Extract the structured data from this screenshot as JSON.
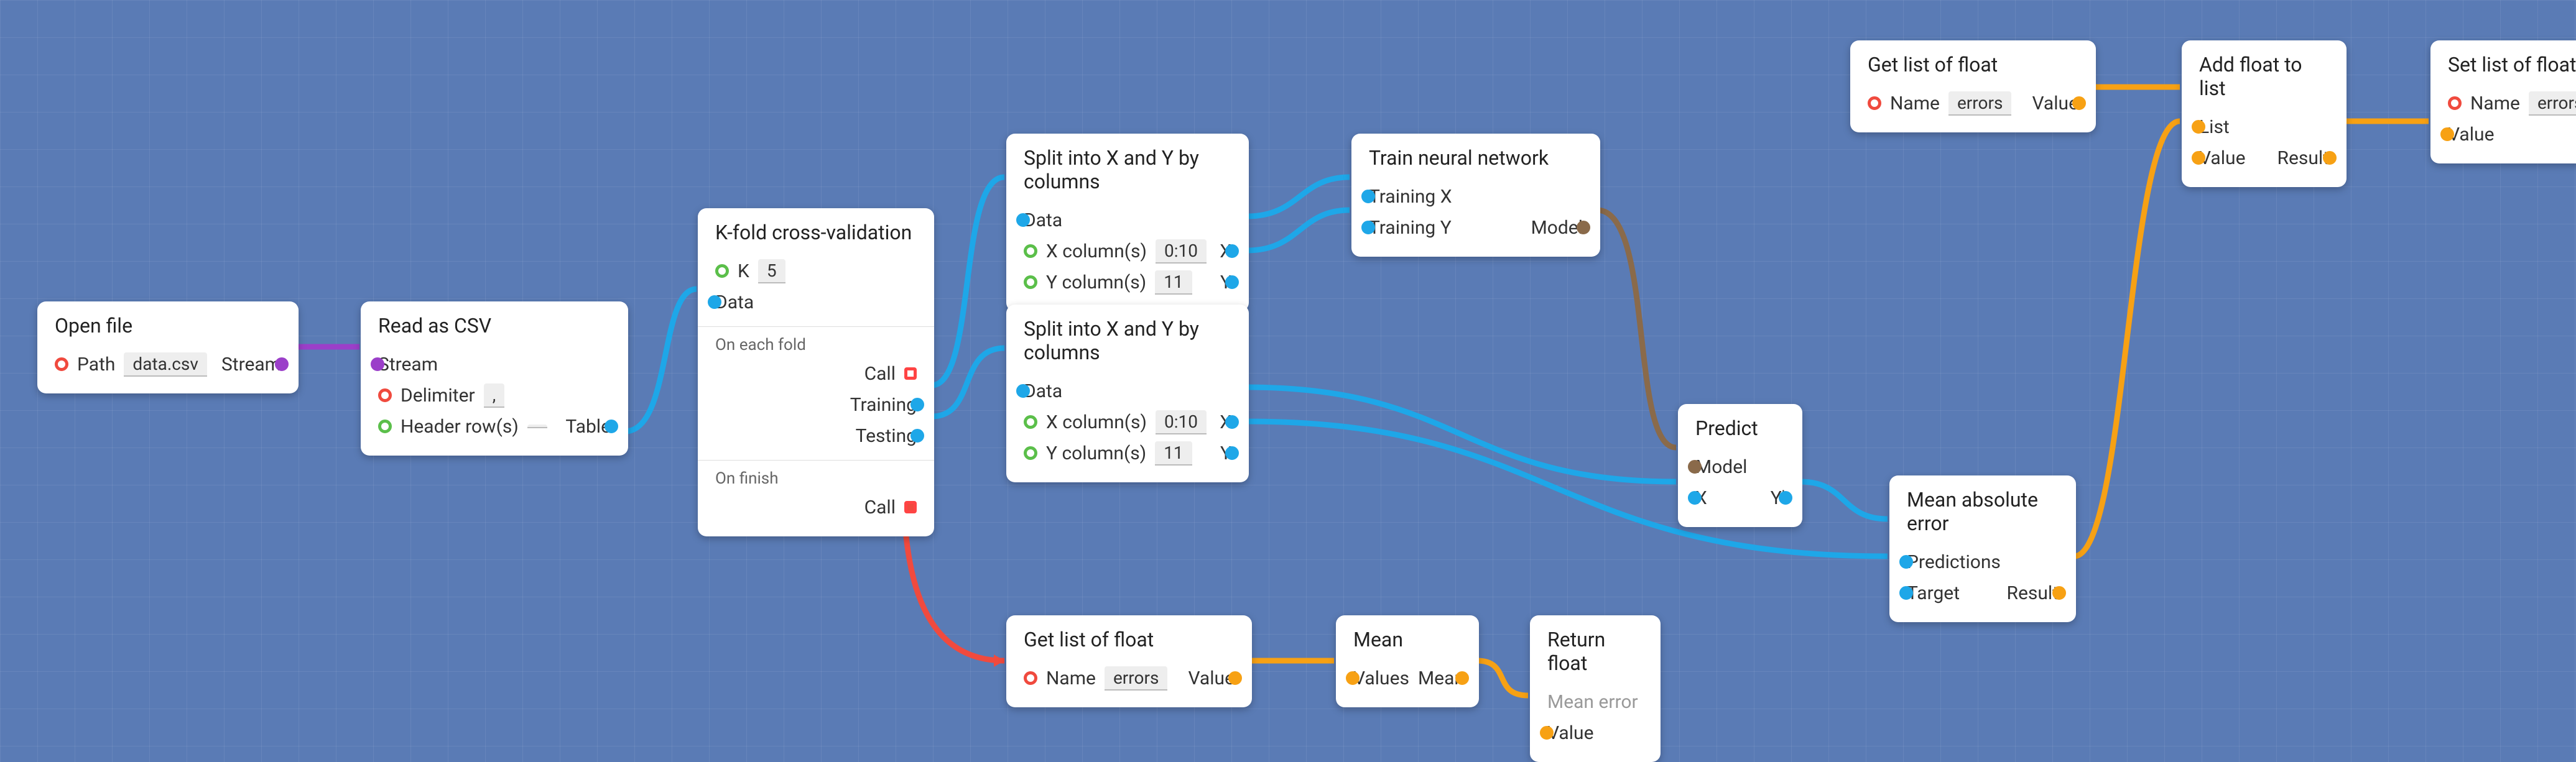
{
  "nodes": {
    "open_file": {
      "title": "Open file",
      "path_label": "Path",
      "path_value": "data.csv",
      "stream_label": "Stream"
    },
    "read_csv": {
      "title": "Read as CSV",
      "stream_label": "Stream",
      "delimiter_label": "Delimiter",
      "delimiter_value": ",",
      "header_label": "Header row(s)",
      "header_value": "",
      "table_label": "Table"
    },
    "kfold": {
      "title": "K-fold cross-validation",
      "k_label": "K",
      "k_value": "5",
      "data_label": "Data",
      "section_each": "On each fold",
      "call_label": "Call",
      "training_label": "Training",
      "testing_label": "Testing",
      "section_finish": "On finish"
    },
    "split1": {
      "title": "Split into X and Y by columns",
      "data_label": "Data",
      "xcol_label": "X column(s)",
      "xcol_value": "0:10",
      "ycol_label": "Y column(s)",
      "ycol_value": "11",
      "x_label": "X",
      "y_label": "Y"
    },
    "split2": {
      "title": "Split into X and Y by columns",
      "data_label": "Data",
      "xcol_label": "X column(s)",
      "xcol_value": "0:10",
      "ycol_label": "Y column(s)",
      "ycol_value": "11",
      "x_label": "X",
      "y_label": "Y"
    },
    "train": {
      "title": "Train neural network",
      "tx_label": "Training X",
      "ty_label": "Training Y",
      "model_label": "Model"
    },
    "predict": {
      "title": "Predict",
      "model_label": "Model",
      "x_label": "X",
      "y_label": "Y'"
    },
    "mae": {
      "title": "Mean absolute error",
      "pred_label": "Predictions",
      "target_label": "Target",
      "result_label": "Result"
    },
    "get_errors": {
      "title": "Get list of float",
      "name_label": "Name",
      "name_value": "errors",
      "value_label": "Value"
    },
    "add_float": {
      "title": "Add float to list",
      "list_label": "List",
      "value_label": "Value",
      "result_label": "Result"
    },
    "set_errors": {
      "title": "Set list of float",
      "name_label": "Name",
      "name_value": "errors",
      "value_label": "Value"
    },
    "get_errors2": {
      "title": "Get list of float",
      "name_label": "Name",
      "name_value": "errors",
      "value_label": "Value"
    },
    "mean": {
      "title": "Mean",
      "values_label": "Values",
      "mean_label": "Mean"
    },
    "return": {
      "title": "Return float",
      "hint": "Mean error",
      "value_label": "Value"
    }
  }
}
